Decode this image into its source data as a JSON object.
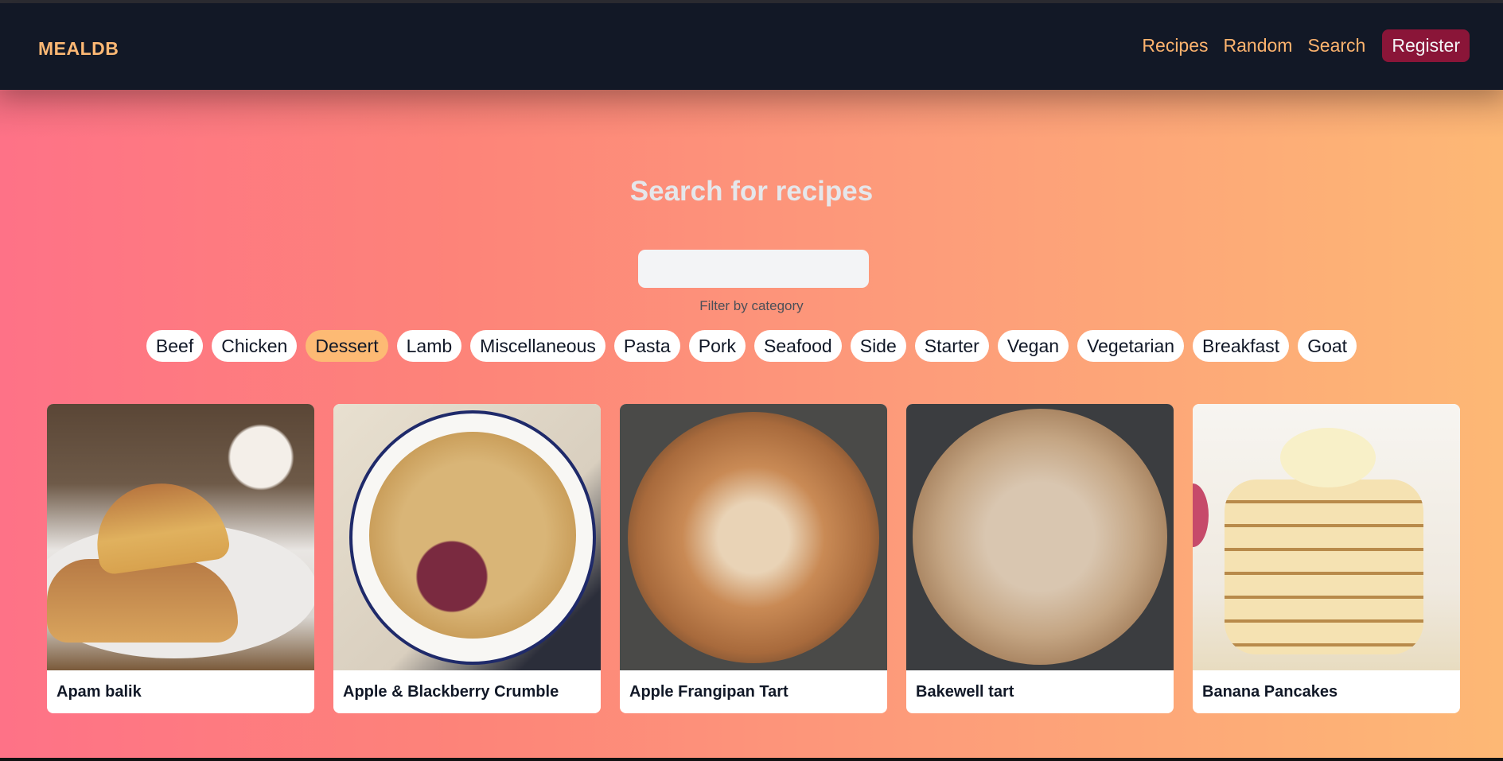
{
  "navbar": {
    "brand": "MEALDB",
    "links": [
      "Recipes",
      "Random",
      "Search"
    ],
    "register_label": "Register",
    "colors": {
      "background": "#121826",
      "link": "#fdb36e",
      "register_bg": "#8a1538"
    }
  },
  "search": {
    "title": "Search for recipes",
    "input_value": "",
    "input_placeholder": "",
    "filter_label": "Filter by category"
  },
  "categories": {
    "items": [
      "Beef",
      "Chicken",
      "Dessert",
      "Lamb",
      "Miscellaneous",
      "Pasta",
      "Pork",
      "Seafood",
      "Side",
      "Starter",
      "Vegan",
      "Vegetarian",
      "Breakfast",
      "Goat"
    ],
    "selected": "Dessert",
    "active_color": "#fdba74"
  },
  "results": [
    {
      "title": "Apam balik",
      "image": "apam-balik-photo"
    },
    {
      "title": "Apple & Blackberry Crumble",
      "image": "crumble-photo"
    },
    {
      "title": "Apple Frangipan Tart",
      "image": "frangipan-tart-photo"
    },
    {
      "title": "Bakewell tart",
      "image": "bakewell-tart-photo"
    },
    {
      "title": "Banana Pancakes",
      "image": "banana-pancakes-photo"
    }
  ]
}
